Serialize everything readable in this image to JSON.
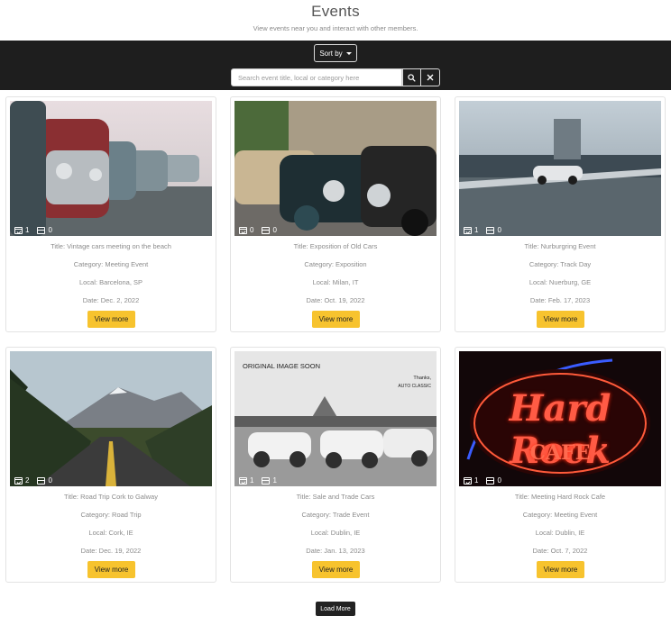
{
  "header": {
    "title": "Events",
    "subtitle": "View events near you and interact with other members."
  },
  "toolbar": {
    "sort_label": "Sort by",
    "search_placeholder": "Search event title, local or category here"
  },
  "events": [
    {
      "title": "Title: Vintage cars meeting on the beach",
      "category": "Category: Meeting Event",
      "local": "Local: Barcelona, SP",
      "date": "Date: Dec. 2, 2022",
      "attending": "1",
      "posts": "0",
      "button": "View more"
    },
    {
      "title": "Title: Exposition of Old Cars",
      "category": "Category: Exposition",
      "local": "Local: Milan, IT",
      "date": "Date: Oct. 19, 2022",
      "attending": "0",
      "posts": "0",
      "button": "View more"
    },
    {
      "title": "Title: Nurburgring Event",
      "category": "Category: Track Day",
      "local": "Local: Nuerburg, GE",
      "date": "Date: Feb. 17, 2023",
      "attending": "1",
      "posts": "0",
      "button": "View more"
    },
    {
      "title": "Title: Road Trip Cork to Galway",
      "category": "Category: Road Trip",
      "local": "Local: Cork, IE",
      "date": "Date: Dec. 19, 2022",
      "attending": "2",
      "posts": "0",
      "button": "View more"
    },
    {
      "title": "Title: Sale and Trade Cars",
      "category": "Category: Trade Event",
      "local": "Local: Dublin, IE",
      "date": "Date: Jan. 13, 2023",
      "attending": "1",
      "posts": "1",
      "button": "View more",
      "image_text": {
        "headline": "ORIGINAL IMAGE SOON",
        "thanks": "Thanks,",
        "brand": "AUTO CLASSIC"
      }
    },
    {
      "title": "Title: Meeting Hard Rock Cafe",
      "category": "Category: Meeting Event",
      "local": "Local: Dublin, IE",
      "date": "Date: Oct. 7, 2022",
      "attending": "1",
      "posts": "0",
      "button": "View more",
      "image_text": {
        "line1": "Hard Rock",
        "line2": "CAFE"
      }
    }
  ],
  "footer": {
    "load_more_label": "Load More"
  }
}
